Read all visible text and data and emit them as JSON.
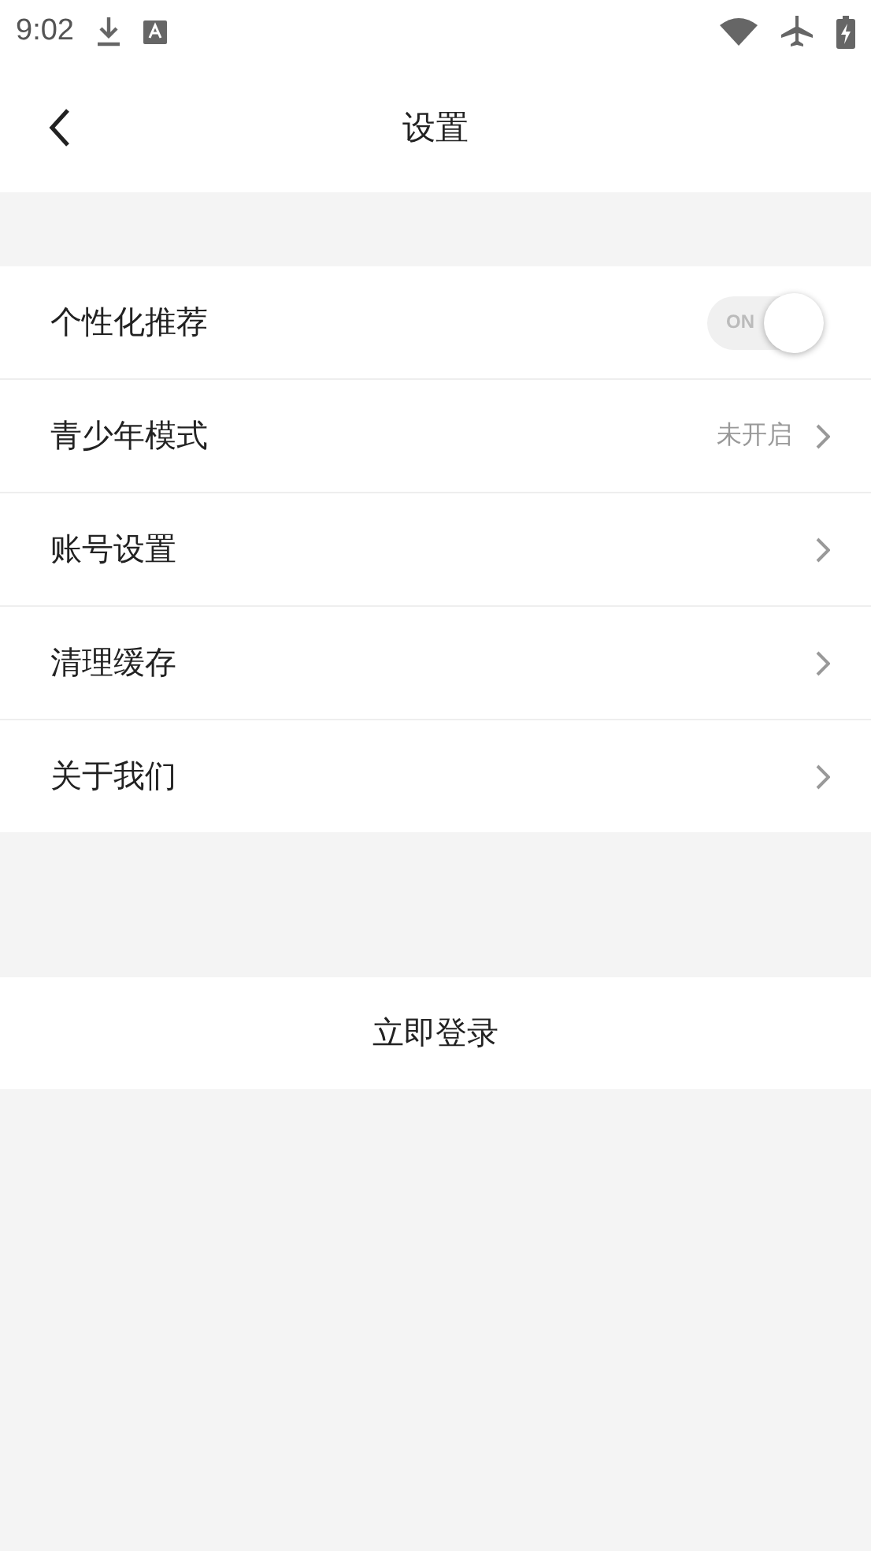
{
  "status_bar": {
    "time": "9:02"
  },
  "header": {
    "title": "设置"
  },
  "settings": [
    {
      "kind": "toggle",
      "label": "个性化推荐",
      "on": true,
      "switch_text": "ON"
    },
    {
      "kind": "link",
      "label": "青少年模式",
      "value": "未开启"
    },
    {
      "kind": "link",
      "label": "账号设置"
    },
    {
      "kind": "link",
      "label": "清理缓存"
    },
    {
      "kind": "link",
      "label": "关于我们"
    }
  ],
  "login_button": "立即登录"
}
